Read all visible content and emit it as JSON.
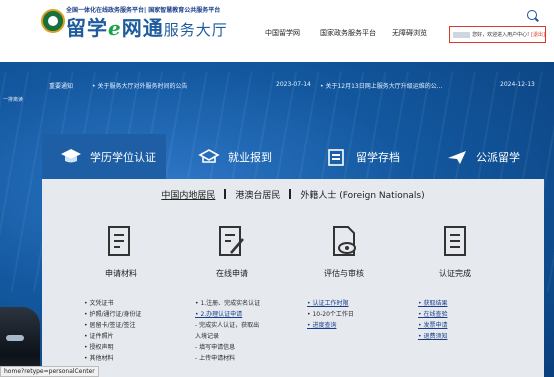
{
  "header": {
    "logo_subtitle": "全国一体化在线政务服务平台| 国家智慧教育公共服务平台",
    "logo_title_a": "留学",
    "logo_title_e": "e",
    "logo_title_b": "网通",
    "logo_title_tail": "服务大厅",
    "nav": [
      "中国留学网",
      "国家政务服务平台",
      "无障碍浏览"
    ],
    "user_greeting": "您好，欢迎进入用户中心!",
    "user_exit": "[退出]"
  },
  "notices": {
    "label": "重要通知",
    "items": [
      {
        "text": "• 关于服务大厅对外服务时间的公告",
        "date": "2023-07-14"
      },
      {
        "text": "• 关于12月13日网上服务大厅升级运维的公...",
        "date": "2024-12-13"
      }
    ],
    "side_label": "一排离读"
  },
  "tabs": [
    "学历学位认证",
    "就业报到",
    "留学存档",
    "公派留学"
  ],
  "regions": [
    "中国内地居民",
    "港澳台居民",
    "外籍人士 (Foreign Nationals)"
  ],
  "steps": [
    {
      "label": "申请材料",
      "icon": "document-list-icon",
      "items": [
        "• 文凭证书",
        "• 护照/通行证/身份证",
        "• 居留卡/签证/签注",
        "• 证件照片",
        "• 授权声明",
        "• 其他材料"
      ]
    },
    {
      "label": "在线申请",
      "icon": "edit-form-icon",
      "items": [
        "• 1.注册、完成实名认证",
        "• 2.办理认证申请",
        "  - 完成实人认证，获取出",
        "    入境记录",
        "  - 填写申请信息",
        "  - 上传申请材料"
      ]
    },
    {
      "label": "评估与审核",
      "icon": "document-review-icon",
      "items": [
        "• 认证工作时限",
        "• 10-20个工作日",
        "• 进度查询"
      ]
    },
    {
      "label": "认证完成",
      "icon": "certificate-icon",
      "items": [
        "• 获取结果",
        "• 在线查验",
        "• 发票申请",
        "• 退费须知"
      ]
    }
  ],
  "status_url": "home?retype=personalCenter",
  "colors": {
    "banner": "#0b4f93",
    "tab_active": "#1d5ea4",
    "panel": "#e6e9ee",
    "user_box_border": "#e0392b"
  }
}
